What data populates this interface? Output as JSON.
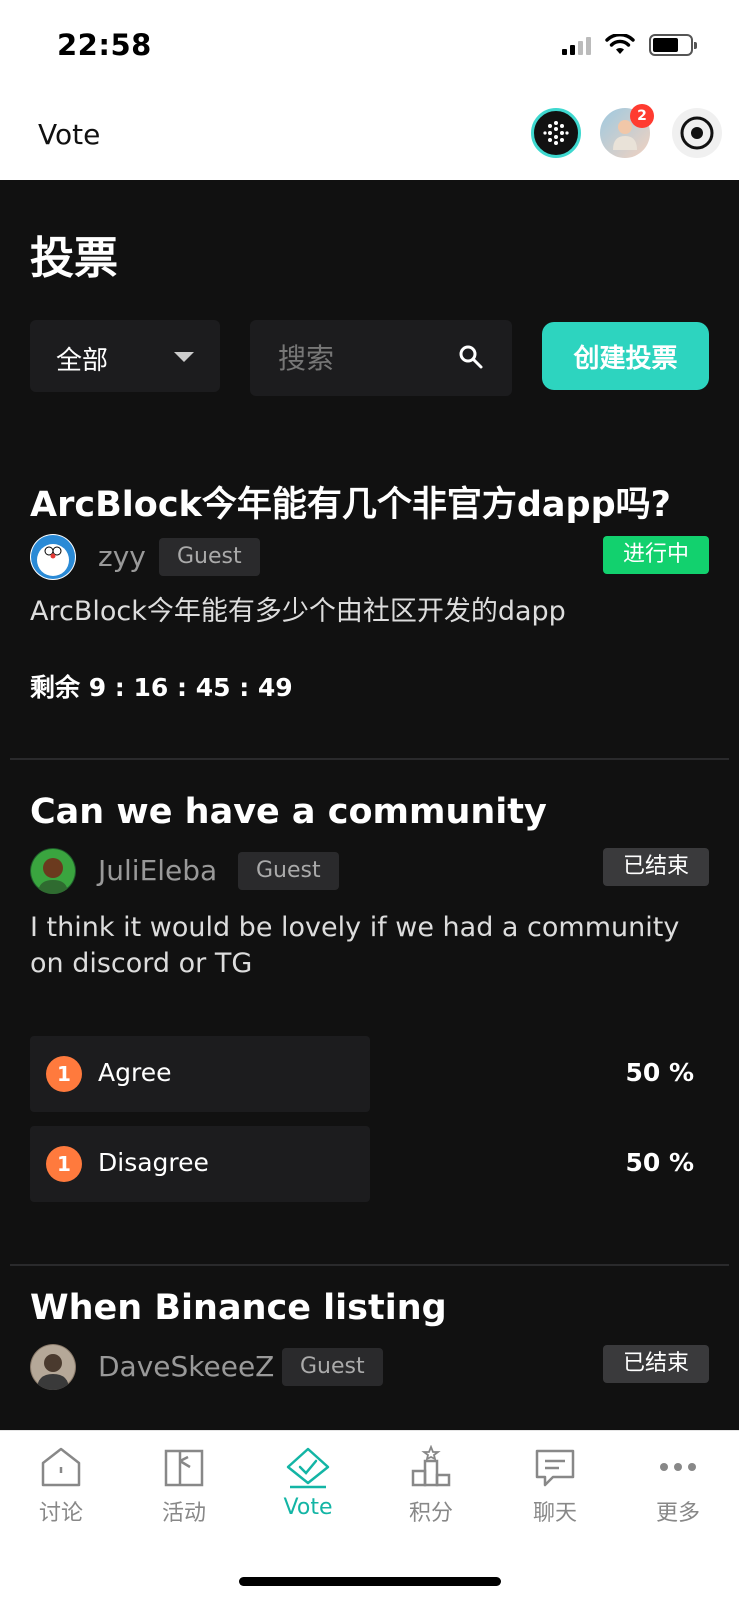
{
  "status": {
    "time": "22:58"
  },
  "header": {
    "title": "Vote",
    "badge_count": "2"
  },
  "page": {
    "title": "投票"
  },
  "toolbar": {
    "filter_label": "全部",
    "search_placeholder": "搜索",
    "create_label": "创建投票"
  },
  "polls": [
    {
      "title": "ArcBlock今年能有几个非官方dapp吗?",
      "author": "zyy",
      "role": "Guest",
      "status": "进行中",
      "description": "ArcBlock今年能有多少个由社区开发的dapp",
      "countdown": "剩余 9 : 16 : 45 : 49"
    },
    {
      "title": "Can we have a community",
      "author": "JuliEleba",
      "role": "Guest",
      "status": "已结束",
      "description": "I think it would be lovely if we had a community on discord or TG",
      "options": [
        {
          "count": "1",
          "label": "Agree",
          "percent": "50 %",
          "share": 0.5
        },
        {
          "count": "1",
          "label": "Disagree",
          "percent": "50 %",
          "share": 0.5
        }
      ]
    },
    {
      "title": "When Binance listing",
      "author": "DaveSkeeeZ",
      "role": "Guest",
      "status": "已结束"
    }
  ],
  "nav": {
    "items": [
      {
        "label": "讨论",
        "icon": "home-icon"
      },
      {
        "label": "活动",
        "icon": "gift-icon"
      },
      {
        "label": "Vote",
        "icon": "vote-icon",
        "active": true
      },
      {
        "label": "积分",
        "icon": "podium-icon"
      },
      {
        "label": "聊天",
        "icon": "chat-icon"
      },
      {
        "label": "更多",
        "icon": "more-icon"
      }
    ]
  },
  "colors": {
    "accent": "#2dd4bf",
    "live": "#12d16e",
    "background": "#111111",
    "vote_count": "#ff7a3d"
  }
}
